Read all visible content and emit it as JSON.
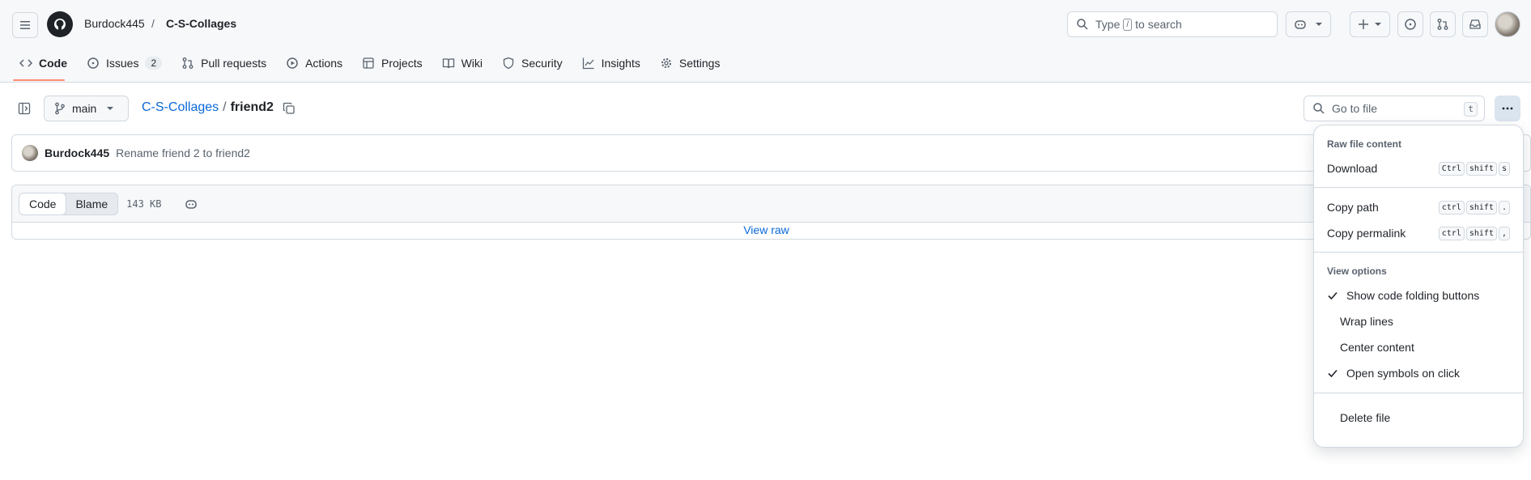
{
  "header": {
    "owner": "Burdock445",
    "separator": "/",
    "repo": "C-S-Collages",
    "search": {
      "text_before": "Type",
      "key": "/",
      "text_after": "to search"
    }
  },
  "tabs": [
    {
      "label": "Code",
      "icon": "code-icon",
      "active": true
    },
    {
      "label": "Issues",
      "icon": "issue-icon",
      "count": "2"
    },
    {
      "label": "Pull requests",
      "icon": "pull-request-icon"
    },
    {
      "label": "Actions",
      "icon": "play-icon"
    },
    {
      "label": "Projects",
      "icon": "table-icon"
    },
    {
      "label": "Wiki",
      "icon": "book-icon"
    },
    {
      "label": "Security",
      "icon": "shield-icon"
    },
    {
      "label": "Insights",
      "icon": "graph-icon"
    },
    {
      "label": "Settings",
      "icon": "gear-icon"
    }
  ],
  "file_header": {
    "branch": "main",
    "repo_link": "C-S-Collages",
    "path_sep": "/",
    "file_name": "friend2",
    "goto_placeholder": "Go to file",
    "goto_key": "t"
  },
  "commit": {
    "author": "Burdock445",
    "message": "Rename friend 2 to friend2"
  },
  "file_view": {
    "code_label": "Code",
    "blame_label": "Blame",
    "size": "143 KB",
    "view_raw": "View raw"
  },
  "menu": {
    "raw_title": "Raw file content",
    "download": {
      "label": "Download",
      "keys": [
        "Ctrl",
        "shift",
        "s"
      ]
    },
    "copy_path": {
      "label": "Copy path",
      "keys": [
        "ctrl",
        "shift",
        "."
      ]
    },
    "copy_permalink": {
      "label": "Copy permalink",
      "keys": [
        "ctrl",
        "shift",
        ","
      ]
    },
    "view_title": "View options",
    "show_folding": {
      "label": "Show code folding buttons",
      "checked": true
    },
    "wrap_lines": {
      "label": "Wrap lines",
      "checked": false
    },
    "center_content": {
      "label": "Center content",
      "checked": false
    },
    "open_symbols": {
      "label": "Open symbols on click",
      "checked": true
    },
    "delete_file": {
      "label": "Delete file"
    }
  },
  "colors": {
    "accent_link": "#0969da",
    "tab_underline": "#fd8c73"
  }
}
